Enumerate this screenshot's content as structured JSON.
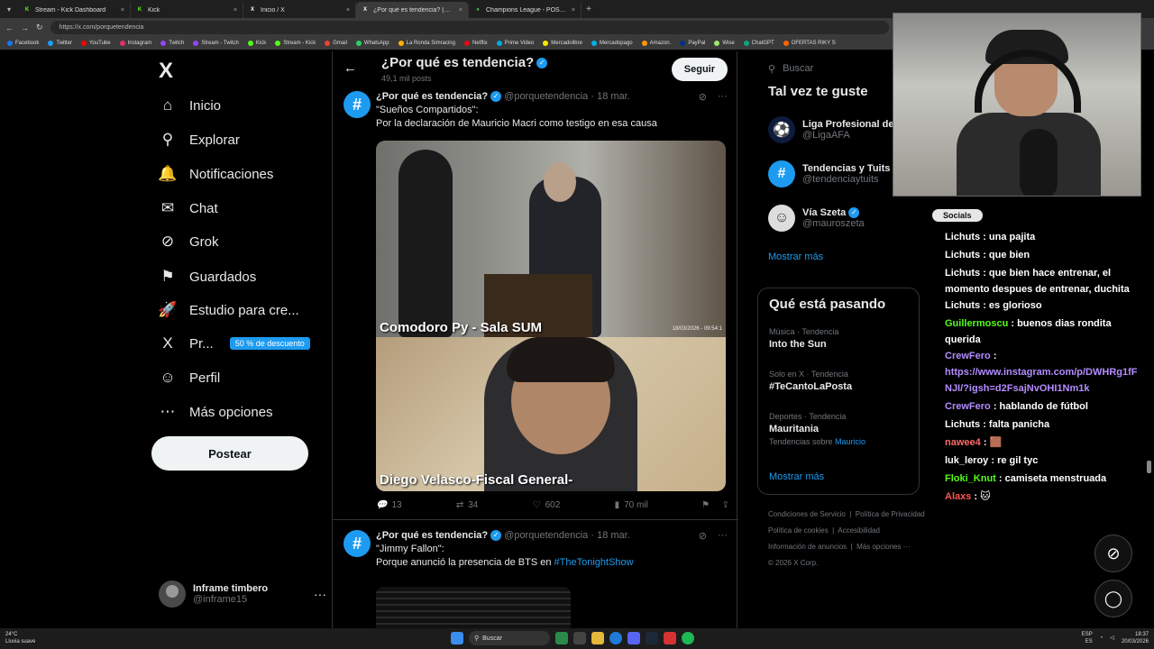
{
  "browser": {
    "tabs": [
      {
        "label": "Stream - Kick Dashboard",
        "fav": "K",
        "color": "#53fc18"
      },
      {
        "label": "Kick",
        "fav": "K",
        "color": "#53fc18"
      },
      {
        "label": "Inicio / X",
        "fav": "X",
        "color": "#ffffff"
      },
      {
        "label": "¿Por qué es tendencia? (@po",
        "fav": "X",
        "color": "#ffffff"
      },
      {
        "label": "Champions League - POSICIONES",
        "fav": "●",
        "color": "#3fbf5f"
      }
    ],
    "url": "https://x.com/porquetendencia",
    "bookmarks": [
      "Facebook",
      "Twitter",
      "YouTube",
      "Instagram",
      "Twitch",
      "Stream - Twitch",
      "Kick",
      "Stream - Kick",
      "Gmail",
      "WhatsApp",
      "La Ronda Simracing",
      "Netflix",
      "Prime Video",
      "Mercadolibre",
      "Mercadopago",
      "Amazon.",
      "PayPal",
      "Wise",
      "ChatGPT",
      "OFERTAS RIKY S"
    ]
  },
  "sidebar": {
    "logo": "X",
    "items": [
      {
        "label": "Inicio",
        "icon": "home-icon",
        "glyph": "⌂"
      },
      {
        "label": "Explorar",
        "icon": "search-icon",
        "glyph": "⚲"
      },
      {
        "label": "Notificaciones",
        "icon": "bell-icon",
        "glyph": "🔔"
      },
      {
        "label": "Chat",
        "icon": "mail-icon",
        "glyph": "✉"
      },
      {
        "label": "Grok",
        "icon": "grok-icon",
        "glyph": "⊘"
      },
      {
        "label": "Guardados",
        "icon": "bookmark-icon",
        "glyph": "⚑"
      },
      {
        "label": "Estudio para cre...",
        "icon": "rocket-icon",
        "glyph": "🚀"
      },
      {
        "label": "Pr...",
        "icon": "x-premium-icon",
        "glyph": "X"
      },
      {
        "label": "Perfil",
        "icon": "person-icon",
        "glyph": "☺"
      },
      {
        "label": "Más opciones",
        "icon": "more-circle-icon",
        "glyph": "⋯"
      }
    ],
    "premium_badge": "50 % de descuento",
    "post_button": "Postear",
    "account": {
      "name": "Inframe timbero",
      "handle": "@inframe15"
    }
  },
  "center": {
    "title": "¿Por qué es tendencia?",
    "subtitle": "49,1 mil posts",
    "follow": "Seguir",
    "tweets": [
      {
        "name": "¿Por qué es tendencia?",
        "handle": "@porquetendencia",
        "date": "18 mar.",
        "line1": "\"Sueños Compartidos\":",
        "line2": "Por la declaración de Mauricio Macri como testigo en esa causa",
        "caption1": "Comodoro Py - Sala SUM",
        "stamp": "18/03/2026 - 09:54:1",
        "caption2": "Diego Velasco-Fiscal General-",
        "replies": "13",
        "reposts": "34",
        "likes": "602",
        "views": "70 mil"
      },
      {
        "name": "¿Por qué es tendencia?",
        "handle": "@porquetendencia",
        "date": "18 mar.",
        "line1": "\"Jimmy Fallon\":",
        "line2": "Porque anunció la presencia de BTS en ",
        "hashtag": "#TheTonightShow"
      }
    ]
  },
  "right": {
    "search_placeholder": "Buscar",
    "suggest_title": "Tal vez te guste",
    "suggestions": [
      {
        "name": "Liga Profesional de",
        "handle": "@LigaAFA"
      },
      {
        "name": "Tendencias y Tuits",
        "handle": "@tendenciaytuits"
      },
      {
        "name": "Vía Szeta",
        "handle": "@mauroszeta"
      }
    ],
    "show_more": "Mostrar más",
    "trends_title": "Qué está pasando",
    "trends": [
      {
        "meta": "Música · Tendencia",
        "title": "Into the Sun",
        "sub": ""
      },
      {
        "meta": "Solo en X · Tendencia",
        "title": "#TeCantoLaPosta",
        "sub": ""
      },
      {
        "meta": "Deportes · Tendencia",
        "title": "Mauritania",
        "sub": "Tendencias sobre ",
        "sub_link": "Mauricio"
      }
    ],
    "footer": {
      "a": "Condiciones de Servicio",
      "b": "Política de Privacidad",
      "c": "Política de cookies",
      "d": "Accesibilidad",
      "e": "Información de anuncios",
      "f": "Más opciones ···",
      "g": "© 2026 X Corp."
    }
  },
  "stream_chat": {
    "socials": "Socials",
    "messages": [
      {
        "user": "Lichuts",
        "color": "#ffffff",
        "text": ": una pajita"
      },
      {
        "user": "Lichuts",
        "color": "#ffffff",
        "text": ": que bien"
      },
      {
        "user": "Lichuts",
        "color": "#ffffff",
        "text": ": que bien hace entrenar, el momento despues de entrenar, duchita"
      },
      {
        "user": "Lichuts",
        "color": "#ffffff",
        "text": ": es glorioso"
      },
      {
        "user": "Guillermoscu",
        "color": "#53fc18",
        "text": ": buenos dias rondita querida"
      },
      {
        "user": "CrewFero",
        "color": "#b38cff",
        "text": ":",
        "link": "https://www.instagram.com/p/DWHRg1fFNJI/?igsh=d2FsajNvOHI1Nm1k"
      },
      {
        "user": "CrewFero",
        "color": "#b38cff",
        "text": ": hablando de fútbol"
      },
      {
        "user": "Lichuts",
        "color": "#ffffff",
        "text": ": falta panicha"
      },
      {
        "user": "nawee4",
        "color": "#ff6a6a",
        "text": ": 🟫"
      },
      {
        "user": "luk_leroy",
        "color": "#ffffff",
        "text": ": re gil tyc"
      },
      {
        "user": "Floki_Knut",
        "color": "#53fc18",
        "text": ": camiseta menstruada"
      },
      {
        "user": "Alaxs",
        "color": "#ff5555",
        "text": ": 🐱"
      }
    ]
  },
  "taskbar": {
    "temp": "24°C",
    "weather": "Lluvia suave",
    "search": "Buscar",
    "lang1": "ESP",
    "lang2": "ES",
    "time": "18:37",
    "date": "20/03/2026"
  }
}
